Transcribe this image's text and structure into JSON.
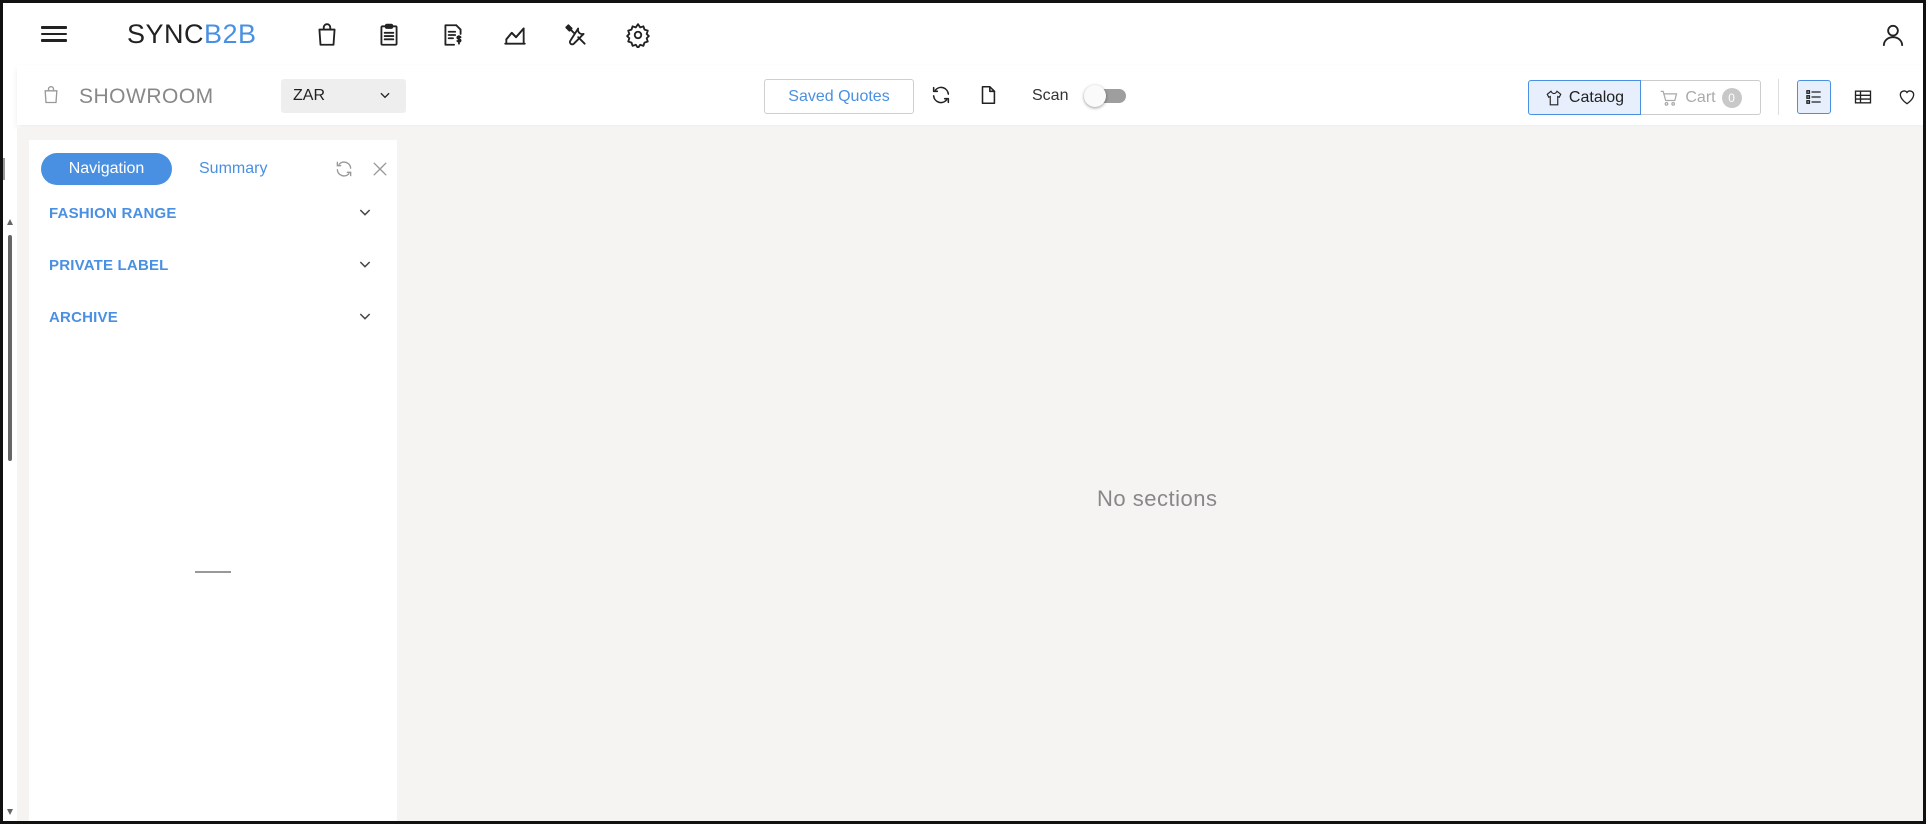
{
  "app": {
    "logo_main": "SYNC",
    "logo_accent": "B2B"
  },
  "topbar": {
    "icons": [
      "shopping-bag-icon",
      "clipboard-icon",
      "invoice-icon",
      "chart-icon",
      "tools-icon",
      "settings-icon"
    ],
    "user_icon": "user-icon"
  },
  "subbar": {
    "section_title": "SHOWROOM",
    "currency": "ZAR",
    "saved_quotes_label": "Saved Quotes",
    "scan_label": "Scan",
    "catalog_label": "Catalog",
    "cart_label": "Cart",
    "cart_count": "0"
  },
  "panel": {
    "tab_navigation": "Navigation",
    "tab_summary": "Summary",
    "items": [
      {
        "label": "FASHION RANGE"
      },
      {
        "label": "PRIVATE LABEL"
      },
      {
        "label": "ARCHIVE"
      }
    ]
  },
  "main": {
    "empty_message": "No sections"
  },
  "colors": {
    "accent": "#4a90e2",
    "content_bg": "#f6f3f3"
  }
}
